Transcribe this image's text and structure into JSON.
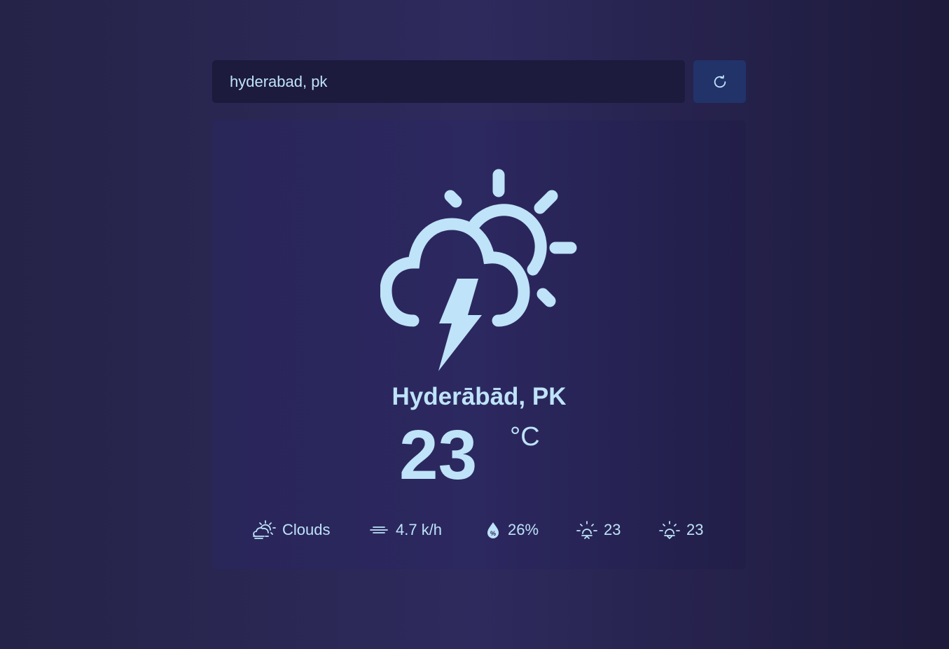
{
  "search": {
    "value": "hyderabad, pk",
    "placeholder": ""
  },
  "refresh": {
    "icon": "refresh-icon"
  },
  "weather": {
    "icon": "thunderstorm-sun-icon",
    "city": "Hyderābād, PK",
    "temperature": "23",
    "unit": "°C"
  },
  "stats": {
    "condition": {
      "icon": "cloud-sun-icon",
      "value": "Clouds"
    },
    "wind": {
      "icon": "wind-icon",
      "value": "4.7 k/h"
    },
    "humidity": {
      "icon": "humidity-drop-icon",
      "value": "26%"
    },
    "temp_max": {
      "icon": "sunrise-icon",
      "value": "23"
    },
    "temp_min": {
      "icon": "sunset-icon",
      "value": "23"
    }
  },
  "colors": {
    "accent": "#bfe3f8",
    "input_bg": "#1c1a3d",
    "button_bg": "#22336a",
    "card_bg": "#29265a"
  }
}
